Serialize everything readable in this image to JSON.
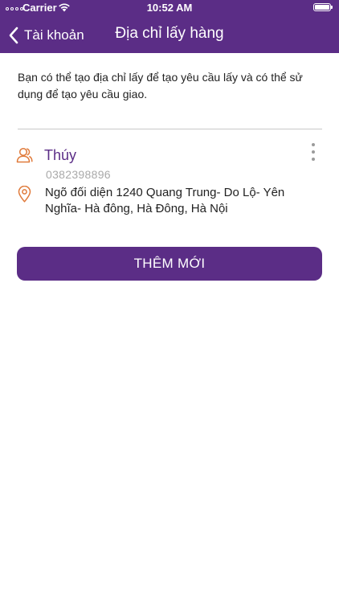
{
  "status_bar": {
    "carrier": "Carrier",
    "time": "10:52 AM"
  },
  "header": {
    "back_label": "Tài khoản",
    "title": "Địa chỉ lấy hàng"
  },
  "description": "Bạn có thể tạo địa chỉ lấy để tạo yêu cầu lấy và có thể sử dụng để tạo yêu cầu giao.",
  "addresses": [
    {
      "name": "Thúy",
      "phone": "0382398896",
      "address": "Ngõ đối diện 1240 Quang Trung- Do Lộ- Yên Nghĩa- Hà đông, Hà Đông, Hà Nội"
    }
  ],
  "add_button_label": "THÊM MỚI",
  "colors": {
    "brand": "#5b2d86",
    "accent_icon": "#e07a3a",
    "muted": "#a9a9a9"
  }
}
